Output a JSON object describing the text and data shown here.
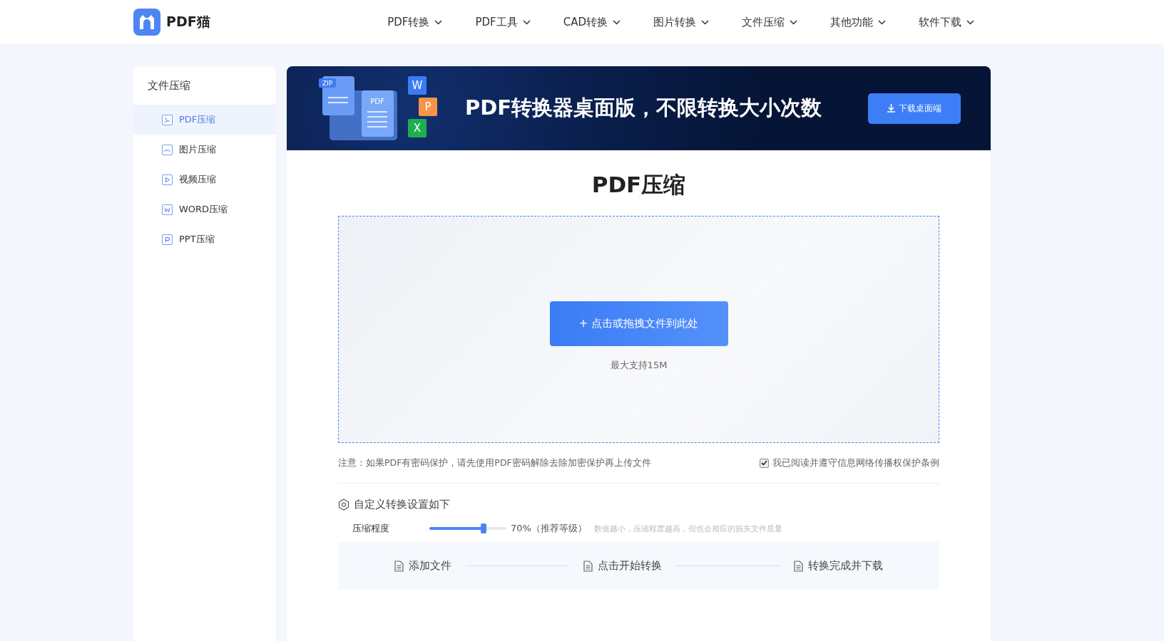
{
  "header": {
    "logo": "PDF猫",
    "nav": [
      {
        "label": "PDF转换"
      },
      {
        "label": "PDF工具"
      },
      {
        "label": "CAD转换"
      },
      {
        "label": "图片转换"
      },
      {
        "label": "文件压缩"
      },
      {
        "label": "其他功能"
      },
      {
        "label": "软件下载"
      }
    ]
  },
  "sidebar": {
    "title": "文件压缩",
    "items": [
      {
        "label": "PDF压缩",
        "kind": "pdf",
        "selected": true
      },
      {
        "label": "图片压缩",
        "kind": "image",
        "selected": false
      },
      {
        "label": "视频压缩",
        "kind": "video",
        "selected": false
      },
      {
        "label": "WORD压缩",
        "kind": "word",
        "selected": false
      },
      {
        "label": "PPT压缩",
        "kind": "ppt",
        "selected": false
      }
    ]
  },
  "banner": {
    "zip_tag": "ZIP",
    "pdf_tag": "PDF",
    "badges": [
      {
        "label": "W",
        "color": "#3b7cf6"
      },
      {
        "label": "P",
        "color": "#f7934a"
      },
      {
        "label": "X",
        "color": "#1fae4f"
      }
    ],
    "title": "PDF转换器桌面版，不限转换大小次数",
    "button": "下载桌面端"
  },
  "title": "PDF压缩",
  "upload": {
    "button": "+ 点击或拖拽文件到此处",
    "hint": "最大支持15M"
  },
  "notice": "注意：如果PDF有密码保护，请先使用PDF密码解除去除加密保护再上传文件",
  "agreement": {
    "label": "我已阅读并遵守信息网络传播权保护条例",
    "checked": true
  },
  "settings": {
    "title": "自定义转换设置如下",
    "slider": {
      "label": "压缩程度",
      "level": 0.7,
      "reading": "70%（推荐等级）",
      "hint": "数值越小，压缩程度越高，但也会相应的损失文件质量"
    }
  },
  "steps": [
    "添加文件",
    "点击开始转换",
    "转换完成并下载"
  ]
}
